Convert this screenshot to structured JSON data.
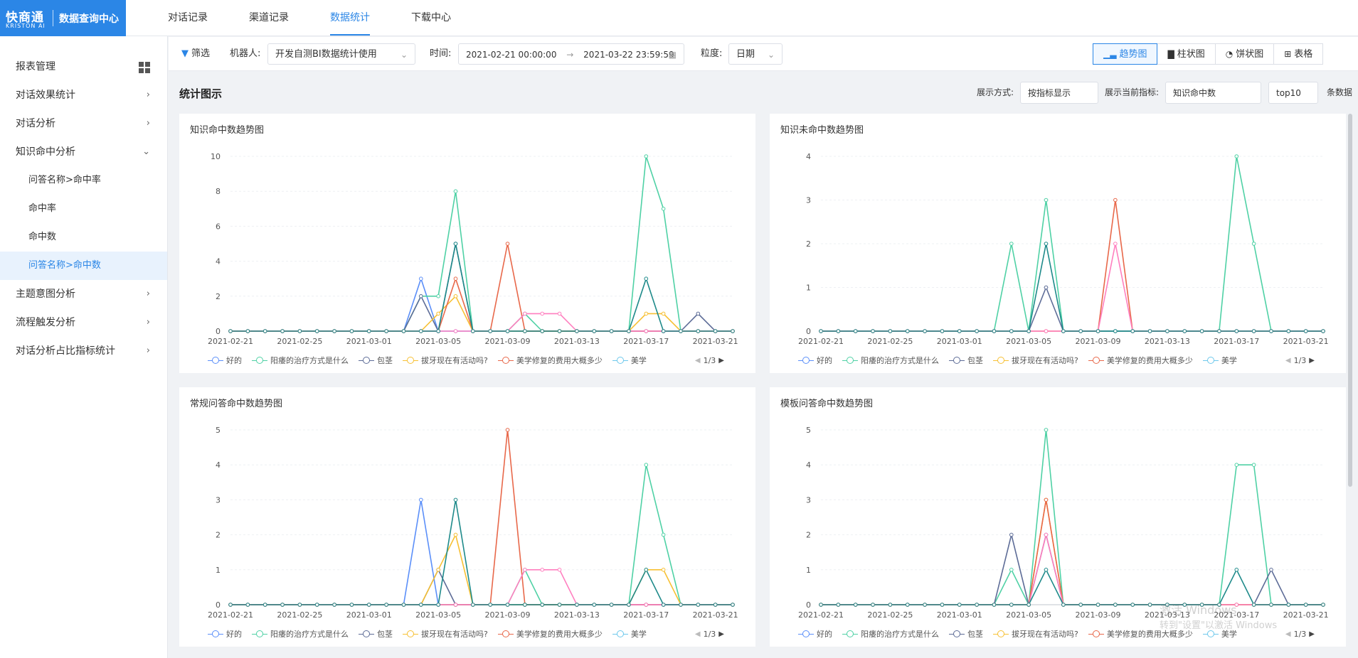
{
  "header": {
    "brand": "快商通",
    "brand_sub": "KRISTON AI",
    "system": "数据查询中心",
    "tabs": [
      {
        "label": "对话记录",
        "active": false
      },
      {
        "label": "渠道记录",
        "active": false
      },
      {
        "label": "数据统计",
        "active": true
      },
      {
        "label": "下载中心",
        "active": false
      }
    ]
  },
  "sidebar": {
    "items": [
      {
        "label": "报表管理",
        "icon": "grid-icon"
      },
      {
        "label": "对话效果统计",
        "arrow": ">"
      },
      {
        "label": "对话分析",
        "arrow": ">"
      },
      {
        "label": "知识命中分析",
        "arrow": "v"
      },
      {
        "label": "问答名称>命中率",
        "sub": true
      },
      {
        "label": "命中率",
        "sub": true
      },
      {
        "label": "命中数",
        "sub": true
      },
      {
        "label": "问答名称>命中数",
        "sub": true,
        "active": true
      },
      {
        "label": "主题意图分析",
        "arrow": ">"
      },
      {
        "label": "流程触发分析",
        "arrow": ">"
      },
      {
        "label": "对话分析占比指标统计",
        "arrow": ">"
      }
    ]
  },
  "toolbar": {
    "filter_label": "筛选",
    "robot_label": "机器人:",
    "robot_value": "开发自测BI数据统计使用",
    "time_label": "时间:",
    "time_start": "2021-02-21 00:00:00",
    "time_sep": "→",
    "time_end": "2021-03-22 23:59:59",
    "granularity_label": "粒度:",
    "granularity_value": "日期",
    "views": [
      {
        "label": "趋势图",
        "icon": "trend-icon",
        "active": true
      },
      {
        "label": "柱状图",
        "icon": "bar-icon",
        "active": false
      },
      {
        "label": "饼状图",
        "icon": "pie-icon",
        "active": false
      },
      {
        "label": "表格",
        "icon": "table-icon",
        "active": false
      }
    ]
  },
  "stats": {
    "title": "统计图示",
    "display_mode_label": "展示方式:",
    "display_mode_value": "按指标显示",
    "metric_label": "展示当前指标:",
    "metric_value": "知识命中数",
    "top_value": "top10",
    "count_suffix": "条数据"
  },
  "legend": {
    "items": [
      "好的",
      "阳痿的治疗方式是什么",
      "包茎",
      "拔牙现在有活动吗?",
      "美学修复的费用大概多少",
      "美学"
    ],
    "colors": [
      "#5b8ff9",
      "#4fd1a5",
      "#5d6c97",
      "#f7c033",
      "#e8684a",
      "#6dc8ec"
    ],
    "pager": "1/3"
  },
  "colors": {
    "s1": "#5b8ff9",
    "s2": "#4fd1a5",
    "s3": "#5d6c97",
    "s4": "#f7c033",
    "s5": "#e8684a",
    "s6": "#ff7fbf",
    "s7": "#1e8a8a",
    "accent": "#2b86e6"
  },
  "watermark": {
    "line1": "激活 Windows",
    "line2": "转到\"设置\"以激活 Windows"
  },
  "chart_data": [
    {
      "type": "line",
      "title": "知识命中数趋势图",
      "x_ticks": [
        "2021-02-21",
        "2021-02-25",
        "2021-03-01",
        "2021-03-05",
        "2021-03-09",
        "2021-03-13",
        "2021-03-17",
        "2021-03-21"
      ],
      "yticks": [
        0,
        2,
        4,
        6,
        8,
        10
      ],
      "ylim": [
        0,
        10
      ],
      "series": [
        {
          "name": "好的",
          "color": "#5b8ff9",
          "values": [
            0,
            0,
            0,
            0,
            0,
            0,
            0,
            0,
            0,
            0,
            0,
            3,
            0,
            0,
            0,
            0,
            0,
            0,
            0,
            0,
            0,
            0,
            0,
            0,
            0,
            0,
            0,
            0,
            0,
            0
          ]
        },
        {
          "name": "阳痿的治疗方式是什么",
          "color": "#4fd1a5",
          "values": [
            0,
            0,
            0,
            0,
            0,
            0,
            0,
            0,
            0,
            0,
            0,
            2,
            2,
            8,
            0,
            0,
            0,
            1,
            0,
            0,
            0,
            0,
            0,
            0,
            10,
            7,
            0,
            0,
            0,
            0
          ]
        },
        {
          "name": "包茎",
          "color": "#5d6c97",
          "values": [
            0,
            0,
            0,
            0,
            0,
            0,
            0,
            0,
            0,
            0,
            0,
            2,
            0,
            5,
            0,
            0,
            0,
            0,
            0,
            0,
            0,
            0,
            0,
            0,
            0,
            0,
            0,
            1,
            0,
            0
          ]
        },
        {
          "name": "拔牙现在有活动吗?",
          "color": "#f7c033",
          "values": [
            0,
            0,
            0,
            0,
            0,
            0,
            0,
            0,
            0,
            0,
            0,
            0,
            1,
            2,
            0,
            0,
            0,
            0,
            0,
            0,
            0,
            0,
            0,
            0,
            1,
            1,
            0,
            0,
            0,
            0
          ]
        },
        {
          "name": "美学修复的费用大概多少",
          "color": "#e8684a",
          "values": [
            0,
            0,
            0,
            0,
            0,
            0,
            0,
            0,
            0,
            0,
            0,
            0,
            0,
            3,
            0,
            0,
            5,
            0,
            0,
            0,
            0,
            0,
            0,
            0,
            0,
            0,
            0,
            0,
            0,
            0
          ]
        },
        {
          "color": "#ff7fbf",
          "values": [
            0,
            0,
            0,
            0,
            0,
            0,
            0,
            0,
            0,
            0,
            0,
            0,
            0,
            0,
            0,
            0,
            0,
            1,
            1,
            1,
            0,
            0,
            0,
            0,
            0,
            0,
            0,
            0,
            0,
            0
          ]
        },
        {
          "color": "#1e8a8a",
          "values": [
            0,
            0,
            0,
            0,
            0,
            0,
            0,
            0,
            0,
            0,
            0,
            0,
            0,
            5,
            0,
            0,
            0,
            0,
            0,
            0,
            0,
            0,
            0,
            0,
            3,
            0,
            0,
            0,
            0,
            0
          ]
        }
      ]
    },
    {
      "type": "line",
      "title": "知识未命中数趋势图",
      "x_ticks": [
        "2021-02-21",
        "2021-02-25",
        "2021-03-01",
        "2021-03-05",
        "2021-03-09",
        "2021-03-13",
        "2021-03-17",
        "2021-03-21"
      ],
      "yticks": [
        0,
        1,
        2,
        3,
        4
      ],
      "ylim": [
        0,
        4
      ],
      "series": [
        {
          "name": "阳痿的治疗方式是什么",
          "color": "#4fd1a5",
          "values": [
            0,
            0,
            0,
            0,
            0,
            0,
            0,
            0,
            0,
            0,
            0,
            2,
            0,
            3,
            0,
            0,
            0,
            0,
            0,
            0,
            0,
            0,
            0,
            0,
            4,
            2,
            0,
            0,
            0,
            0
          ]
        },
        {
          "name": "包茎",
          "color": "#5d6c97",
          "values": [
            0,
            0,
            0,
            0,
            0,
            0,
            0,
            0,
            0,
            0,
            0,
            0,
            0,
            1,
            0,
            0,
            0,
            0,
            0,
            0,
            0,
            0,
            0,
            0,
            0,
            0,
            0,
            0,
            0,
            0
          ]
        },
        {
          "name": "美学修复的费用大概多少",
          "color": "#e8684a",
          "values": [
            0,
            0,
            0,
            0,
            0,
            0,
            0,
            0,
            0,
            0,
            0,
            0,
            0,
            0,
            0,
            0,
            0,
            3,
            0,
            0,
            0,
            0,
            0,
            0,
            0,
            0,
            0,
            0,
            0,
            0
          ]
        },
        {
          "color": "#ff7fbf",
          "values": [
            0,
            0,
            0,
            0,
            0,
            0,
            0,
            0,
            0,
            0,
            0,
            0,
            0,
            0,
            0,
            0,
            0,
            2,
            0,
            0,
            0,
            0,
            0,
            0,
            0,
            0,
            0,
            0,
            0,
            0
          ]
        },
        {
          "color": "#1e8a8a",
          "values": [
            0,
            0,
            0,
            0,
            0,
            0,
            0,
            0,
            0,
            0,
            0,
            0,
            0,
            2,
            0,
            0,
            0,
            0,
            0,
            0,
            0,
            0,
            0,
            0,
            0,
            0,
            0,
            0,
            0,
            0
          ]
        }
      ]
    },
    {
      "type": "line",
      "title": "常规问答命中数趋势图",
      "x_ticks": [
        "2021-02-21",
        "2021-02-25",
        "2021-03-01",
        "2021-03-05",
        "2021-03-09",
        "2021-03-13",
        "2021-03-17",
        "2021-03-21"
      ],
      "yticks": [
        0,
        1,
        2,
        3,
        4,
        5
      ],
      "ylim": [
        0,
        5
      ],
      "series": [
        {
          "name": "好的",
          "color": "#5b8ff9",
          "values": [
            0,
            0,
            0,
            0,
            0,
            0,
            0,
            0,
            0,
            0,
            0,
            3,
            0,
            0,
            0,
            0,
            0,
            0,
            0,
            0,
            0,
            0,
            0,
            0,
            0,
            0,
            0,
            0,
            0,
            0
          ]
        },
        {
          "name": "阳痿的治疗方式是什么",
          "color": "#4fd1a5",
          "values": [
            0,
            0,
            0,
            0,
            0,
            0,
            0,
            0,
            0,
            0,
            0,
            0,
            0,
            0,
            0,
            0,
            0,
            1,
            0,
            0,
            0,
            0,
            0,
            0,
            4,
            2,
            0,
            0,
            0,
            0
          ]
        },
        {
          "name": "包茎",
          "color": "#5d6c97",
          "values": [
            0,
            0,
            0,
            0,
            0,
            0,
            0,
            0,
            0,
            0,
            0,
            0,
            1,
            0,
            0,
            0,
            0,
            0,
            0,
            0,
            0,
            0,
            0,
            0,
            0,
            0,
            0,
            0,
            0,
            0
          ]
        },
        {
          "name": "拔牙现在有活动吗?",
          "color": "#f7c033",
          "values": [
            0,
            0,
            0,
            0,
            0,
            0,
            0,
            0,
            0,
            0,
            0,
            0,
            1,
            2,
            0,
            0,
            0,
            0,
            0,
            0,
            0,
            0,
            0,
            0,
            1,
            1,
            0,
            0,
            0,
            0
          ]
        },
        {
          "name": "美学修复的费用大概多少",
          "color": "#e8684a",
          "values": [
            0,
            0,
            0,
            0,
            0,
            0,
            0,
            0,
            0,
            0,
            0,
            0,
            0,
            0,
            0,
            0,
            5,
            0,
            0,
            0,
            0,
            0,
            0,
            0,
            0,
            0,
            0,
            0,
            0,
            0
          ]
        },
        {
          "color": "#ff7fbf",
          "values": [
            0,
            0,
            0,
            0,
            0,
            0,
            0,
            0,
            0,
            0,
            0,
            0,
            0,
            0,
            0,
            0,
            0,
            1,
            1,
            1,
            0,
            0,
            0,
            0,
            0,
            0,
            0,
            0,
            0,
            0
          ]
        },
        {
          "color": "#1e8a8a",
          "values": [
            0,
            0,
            0,
            0,
            0,
            0,
            0,
            0,
            0,
            0,
            0,
            0,
            0,
            3,
            0,
            0,
            0,
            0,
            0,
            0,
            0,
            0,
            0,
            0,
            1,
            0,
            0,
            0,
            0,
            0
          ]
        }
      ]
    },
    {
      "type": "line",
      "title": "模板问答命中数趋势图",
      "x_ticks": [
        "2021-02-21",
        "2021-02-25",
        "2021-03-01",
        "2021-03-05",
        "2021-03-09",
        "2021-03-13",
        "2021-03-17",
        "2021-03-21"
      ],
      "yticks": [
        0,
        1,
        2,
        3,
        4,
        5
      ],
      "ylim": [
        0,
        5
      ],
      "series": [
        {
          "name": "阳痿的治疗方式是什么",
          "color": "#4fd1a5",
          "values": [
            0,
            0,
            0,
            0,
            0,
            0,
            0,
            0,
            0,
            0,
            0,
            1,
            0,
            5,
            0,
            0,
            0,
            0,
            0,
            0,
            0,
            0,
            0,
            0,
            4,
            4,
            0,
            0,
            0,
            0
          ]
        },
        {
          "name": "包茎",
          "color": "#5d6c97",
          "values": [
            0,
            0,
            0,
            0,
            0,
            0,
            0,
            0,
            0,
            0,
            0,
            2,
            0,
            2,
            0,
            0,
            0,
            0,
            0,
            0,
            0,
            0,
            0,
            0,
            0,
            0,
            1,
            0,
            0,
            0
          ]
        },
        {
          "name": "拔牙现在有活动吗?",
          "color": "#f7c033",
          "values": [
            0,
            0,
            0,
            0,
            0,
            0,
            0,
            0,
            0,
            0,
            0,
            0,
            0,
            3,
            0,
            0,
            0,
            0,
            0,
            0,
            0,
            0,
            0,
            0,
            0,
            0,
            0,
            0,
            0,
            0
          ]
        },
        {
          "name": "美学修复的费用大概多少",
          "color": "#e8684a",
          "values": [
            0,
            0,
            0,
            0,
            0,
            0,
            0,
            0,
            0,
            0,
            0,
            0,
            0,
            3,
            0,
            0,
            0,
            0,
            0,
            0,
            0,
            0,
            0,
            0,
            0,
            0,
            0,
            0,
            0,
            0
          ]
        },
        {
          "color": "#ff7fbf",
          "values": [
            0,
            0,
            0,
            0,
            0,
            0,
            0,
            0,
            0,
            0,
            0,
            0,
            0,
            2,
            0,
            0,
            0,
            0,
            0,
            0,
            0,
            0,
            0,
            0,
            0,
            0,
            0,
            0,
            0,
            0
          ]
        },
        {
          "color": "#1e8a8a",
          "values": [
            0,
            0,
            0,
            0,
            0,
            0,
            0,
            0,
            0,
            0,
            0,
            0,
            0,
            1,
            0,
            0,
            0,
            0,
            0,
            0,
            0,
            0,
            0,
            0,
            1,
            0,
            0,
            0,
            0,
            0
          ]
        }
      ]
    }
  ]
}
